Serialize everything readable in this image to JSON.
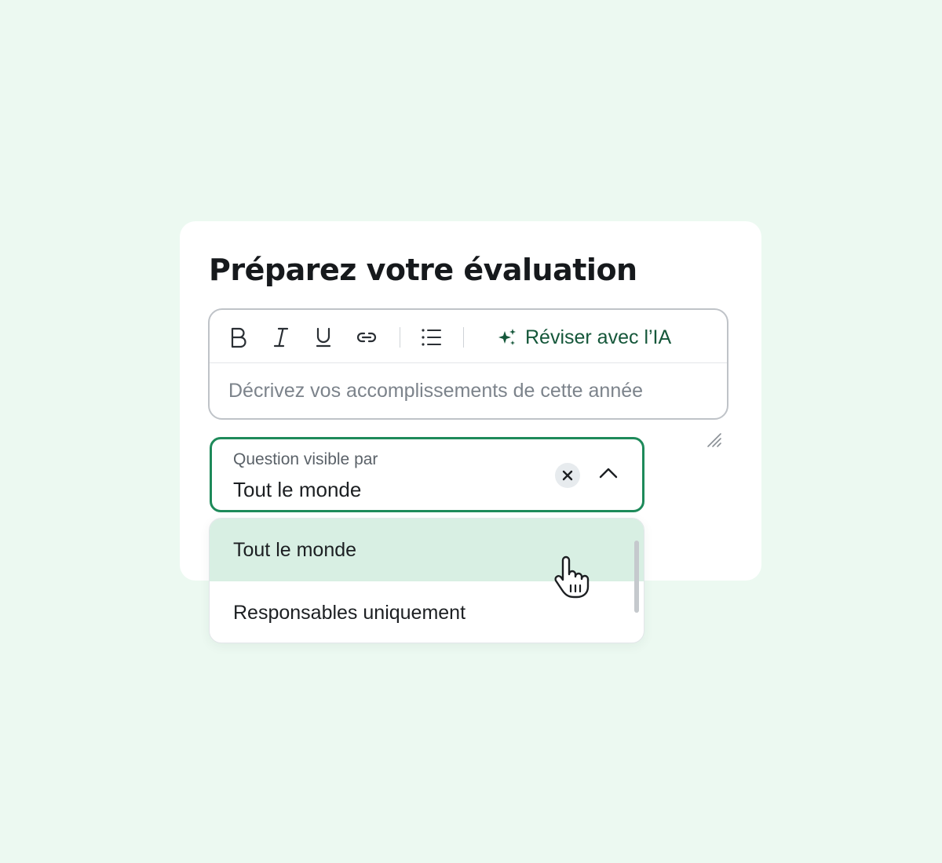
{
  "card": {
    "title": "Préparez votre évaluation"
  },
  "editor": {
    "toolbar": {
      "bold": "bold-icon",
      "italic": "italic-icon",
      "underline": "underline-icon",
      "link": "link-icon",
      "list": "bullet-list-icon",
      "ai_icon": "sparkle-icon",
      "ai_label": "Réviser avec l’IA"
    },
    "placeholder": "Décrivez vos accomplissements de cette année"
  },
  "visibility_select": {
    "label": "Question visible par",
    "value": "Tout le monde",
    "clear_icon": "close-icon",
    "toggle_icon": "chevron-up-icon",
    "open": true,
    "options": [
      {
        "label": "Tout le monde",
        "highlighted": true
      },
      {
        "label": "Responsables uniquement",
        "highlighted": false
      }
    ]
  },
  "colors": {
    "page_background": "#ecf9f1",
    "accent_green": "#1e8a5a",
    "ai_text": "#15573a",
    "option_highlight": "#d8efe3"
  }
}
